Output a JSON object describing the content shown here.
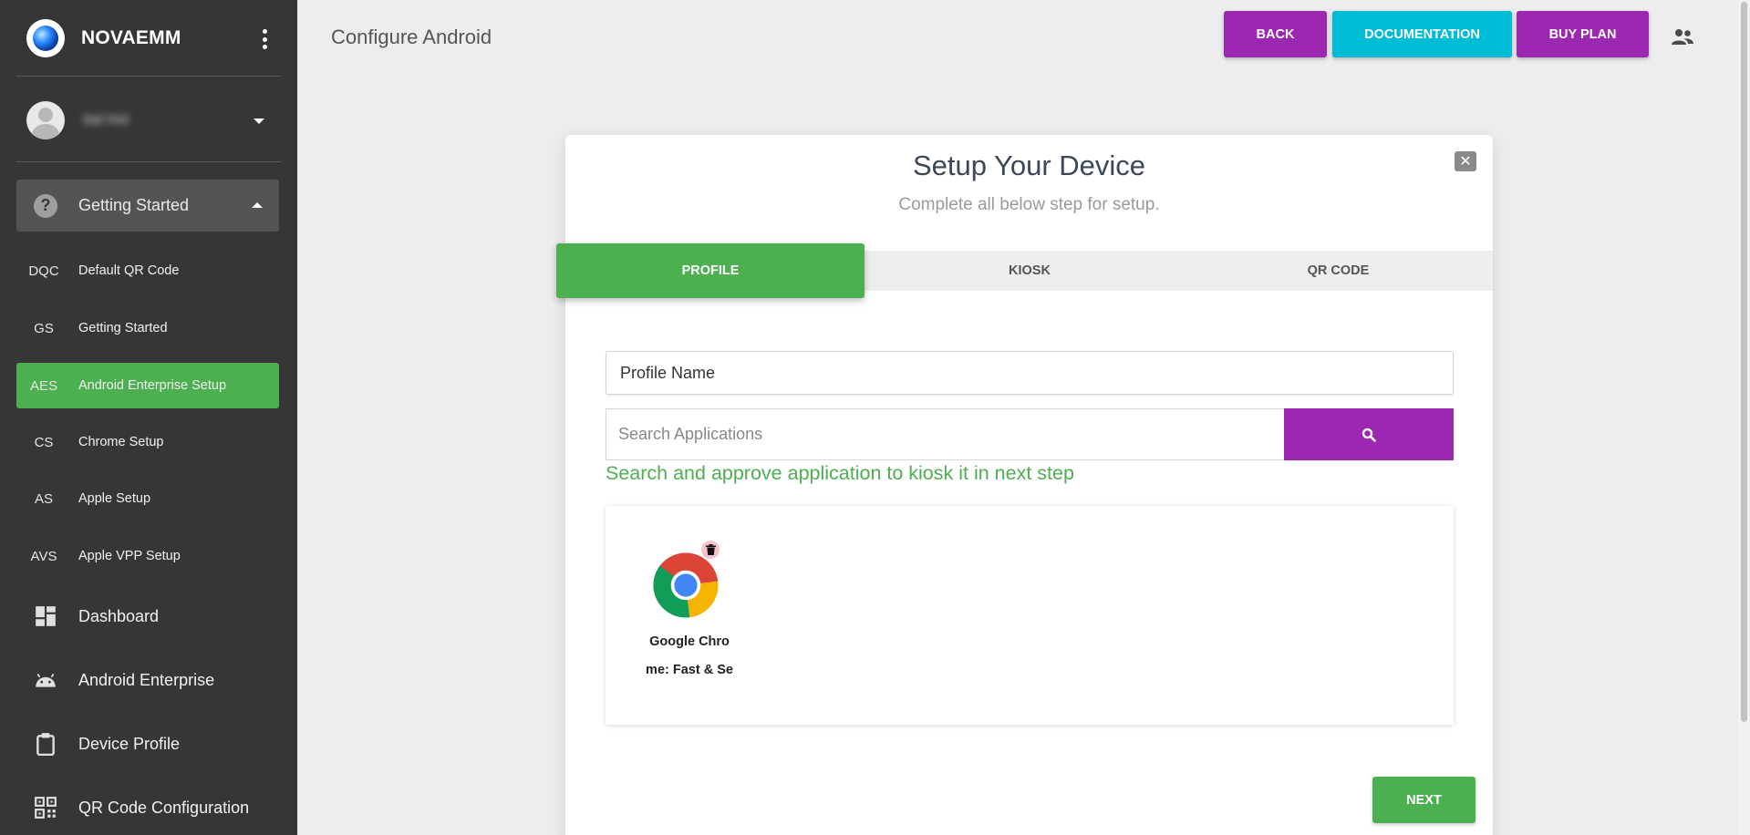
{
  "brand": {
    "name": "NOVAEMM"
  },
  "user": {
    "name": "Ital Hol"
  },
  "sidebar": {
    "group": {
      "label": "Getting Started",
      "icon": "help-icon"
    },
    "sub_items": [
      {
        "abbr": "DQC",
        "label": "Default QR Code",
        "active": false
      },
      {
        "abbr": "GS",
        "label": "Getting Started",
        "active": false
      },
      {
        "abbr": "AES",
        "label": "Android Enterprise Setup",
        "active": true
      },
      {
        "abbr": "CS",
        "label": "Chrome Setup",
        "active": false
      },
      {
        "abbr": "AS",
        "label": "Apple Setup",
        "active": false
      },
      {
        "abbr": "AVS",
        "label": "Apple VPP Setup",
        "active": false
      }
    ],
    "main_items": [
      {
        "label": "Dashboard",
        "icon": "dashboard-icon"
      },
      {
        "label": "Android Enterprise",
        "icon": "android-icon"
      },
      {
        "label": "Device Profile",
        "icon": "clipboard-icon"
      },
      {
        "label": "QR Code Configuration",
        "icon": "qr-code-icon"
      }
    ]
  },
  "header": {
    "title": "Configure Android",
    "buttons": {
      "back": "BACK",
      "documentation": "DOCUMENTATION",
      "buy_plan": "BUY PLAN"
    }
  },
  "modal": {
    "title": "Setup Your Device",
    "subtitle": "Complete all below step for setup.",
    "tabs": [
      {
        "label": "PROFILE",
        "active": true
      },
      {
        "label": "KIOSK",
        "active": false
      },
      {
        "label": "QR CODE",
        "active": false
      }
    ],
    "profile_name": {
      "value": "Profile Name",
      "placeholder": "Profile Name"
    },
    "search": {
      "placeholder": "Search Applications"
    },
    "hint": "Search and approve application to kiosk it in next step",
    "apps": [
      {
        "name_line1": "Google Chro",
        "name_line2": "me: Fast & Se",
        "icon": "chrome-icon"
      }
    ],
    "next_label": "NEXT"
  },
  "colors": {
    "sidebar_bg": "#363636",
    "accent_green": "#4caf50",
    "accent_purple": "#9c27b0",
    "accent_cyan": "#00bcd4"
  }
}
